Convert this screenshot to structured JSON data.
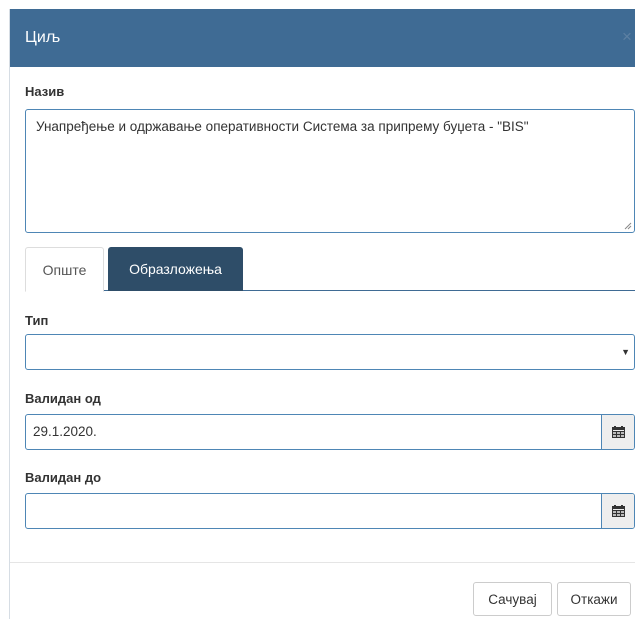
{
  "dialog": {
    "title": "Циљ",
    "close_symbol": "×"
  },
  "name_field": {
    "label": "Назив",
    "value": "Унапређење и одржавање оперативности Система за припрему буџета - \"BIS\""
  },
  "tabs": [
    {
      "label": "Опште",
      "active": true
    },
    {
      "label": "Образложења",
      "active": false
    }
  ],
  "type_field": {
    "label": "Тип",
    "value": ""
  },
  "valid_from": {
    "label": "Валидан од",
    "value": "29.1.2020."
  },
  "valid_to": {
    "label": "Валидан до",
    "value": ""
  },
  "buttons": {
    "save_label": "Сачувај",
    "cancel_label": "Откажи"
  },
  "icons": {
    "calendar": "calendar-icon",
    "dropdown": "caret-down-icon",
    "close": "close-icon"
  },
  "colors": {
    "header_bg": "#3f6b94",
    "active_tab_bg": "#2e4d68",
    "field_border": "#4e86b5"
  }
}
